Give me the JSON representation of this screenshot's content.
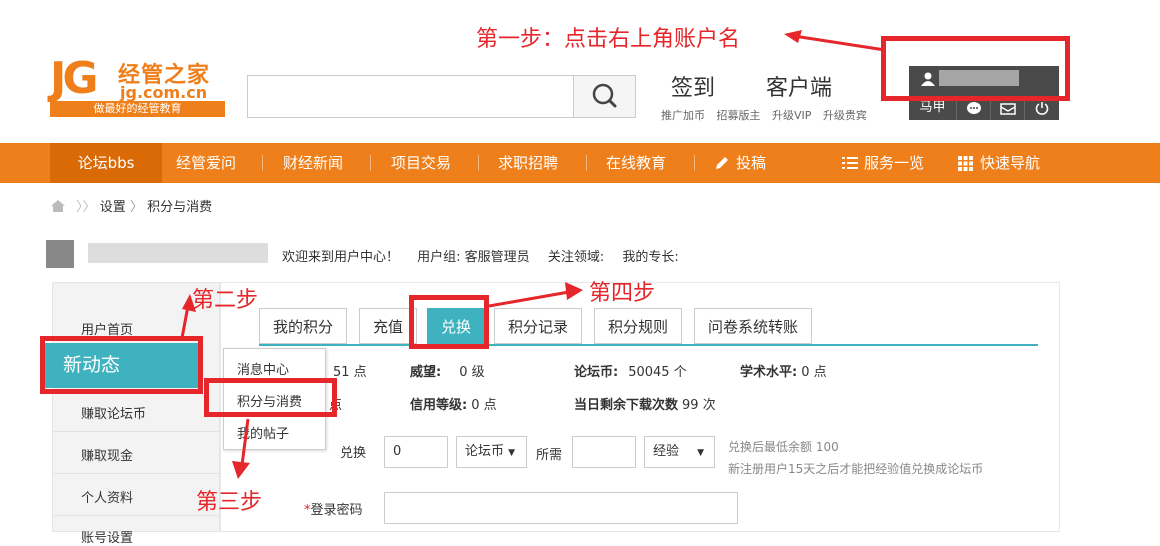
{
  "annotations": {
    "step1": "第一步：点击右上角账户名",
    "step2": "第二步",
    "step3": "第三步",
    "step4": "第四步"
  },
  "header": {
    "logo_mark": "JG",
    "logo_cn": "经管之家",
    "logo_domain": "jg.com.cn",
    "logo_slogan": "做最好的经管教育",
    "search_placeholder": "",
    "signin": "签到",
    "client": "客户端",
    "subnav": [
      "推广加币",
      "招募版主",
      "升级VIP",
      "升级贵宾"
    ],
    "user_name": "马甲"
  },
  "nav": {
    "items": [
      "论坛bbs",
      "经管爱问",
      "财经新闻",
      "项目交易",
      "求职招聘",
      "在线教育",
      "投稿",
      "服务一览",
      "快速导航"
    ]
  },
  "breadcrumb": {
    "items": [
      "设置",
      "积分与消费"
    ]
  },
  "welcome": {
    "text": "欢迎来到用户中心！",
    "group": "用户组: 客服管理员",
    "focus": "关注领域:",
    "skill": "我的专长:"
  },
  "sidebar": {
    "items": [
      "用户首页",
      "新动态",
      "赚取论坛币",
      "赚取现金",
      "个人资料",
      "账号设置"
    ]
  },
  "dropdown": {
    "items": [
      "消息中心",
      "积分与消费",
      "我的帖子"
    ]
  },
  "tabs": [
    "我的积分",
    "充值",
    "兑换",
    "积分记录",
    "积分规则",
    "问卷系统转账"
  ],
  "stats": {
    "row1": [
      {
        "label": "",
        "value": "51 点"
      },
      {
        "label": "威望:",
        "value": "0 级"
      },
      {
        "label": "论坛币:",
        "value": "50045 个"
      },
      {
        "label": "学术水平:",
        "value": "0 点"
      }
    ],
    "row2": [
      {
        "label": "",
        "value": "点"
      },
      {
        "label": "信用等级:",
        "value": "0 点"
      },
      {
        "label": "当日剩余下载次数",
        "value": "99 次"
      }
    ]
  },
  "form": {
    "exchange_label": "兑换",
    "exchange_value": "0",
    "currency": "论坛币",
    "need_label": "所需",
    "need_value": "",
    "exp": "经验",
    "hint1": "兑换后最低余额 100",
    "hint2": "新注册用户15天之后才能把经验值兑换成论坛币",
    "password_label": "登录密码"
  },
  "colors": {
    "orange": "#ef7f1a",
    "teal": "#3fb2bf",
    "annotation_red": "#e5262a"
  }
}
